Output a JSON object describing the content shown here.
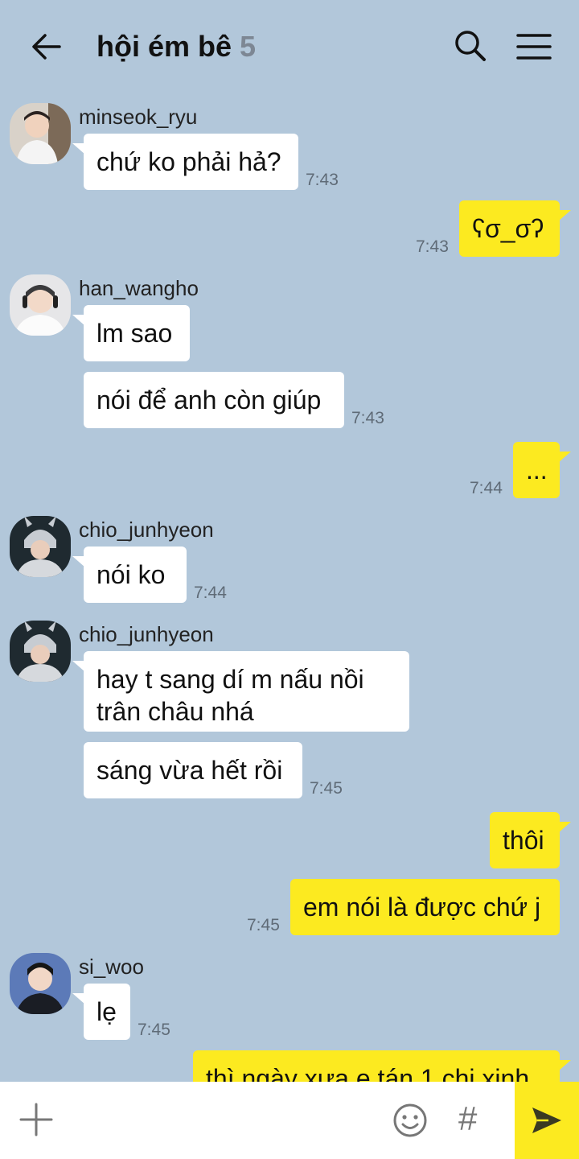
{
  "header": {
    "title": "hội ém bê",
    "member_count": "5",
    "back_icon": "arrow-left-icon",
    "search_icon": "search-icon",
    "menu_icon": "hamburger-menu-icon"
  },
  "messages": [
    {
      "sender": "minseok_ryu",
      "text": "chứ ko phải hả?",
      "time": "7:43"
    },
    {
      "sender": "me",
      "text": "ʕσ_σʔ",
      "time": "7:43"
    },
    {
      "sender": "han_wangho",
      "texts": [
        "lm sao",
        "nói để anh còn giúp"
      ],
      "time": "7:43"
    },
    {
      "sender": "me",
      "text": "...",
      "time": "7:44"
    },
    {
      "sender": "chio_junhyeon",
      "text": "nói ko",
      "time": "7:44"
    },
    {
      "sender": "chio_junhyeon",
      "texts": [
        "hay t sang dí m nấu nồi",
        "trân châu nhá",
        "sáng vừa hết rồi"
      ],
      "time": "7:45"
    },
    {
      "sender": "me",
      "texts": [
        "thôi",
        "em nói là được chứ j"
      ],
      "time": "7:45"
    },
    {
      "sender": "si_woo",
      "text": "lẹ",
      "time": "7:45"
    },
    {
      "sender": "me",
      "text": "thì ngày xưa e tán 1 chị xinh"
    }
  ],
  "input_bar": {
    "plus_icon": "plus-icon",
    "emoji_icon": "emoji-icon",
    "hash_label": "#",
    "send_icon": "send-icon"
  },
  "colors": {
    "background": "#b2c7da",
    "my_bubble": "#fcea20",
    "other_bubble": "#ffffff",
    "time_text": "#5f6b77"
  }
}
